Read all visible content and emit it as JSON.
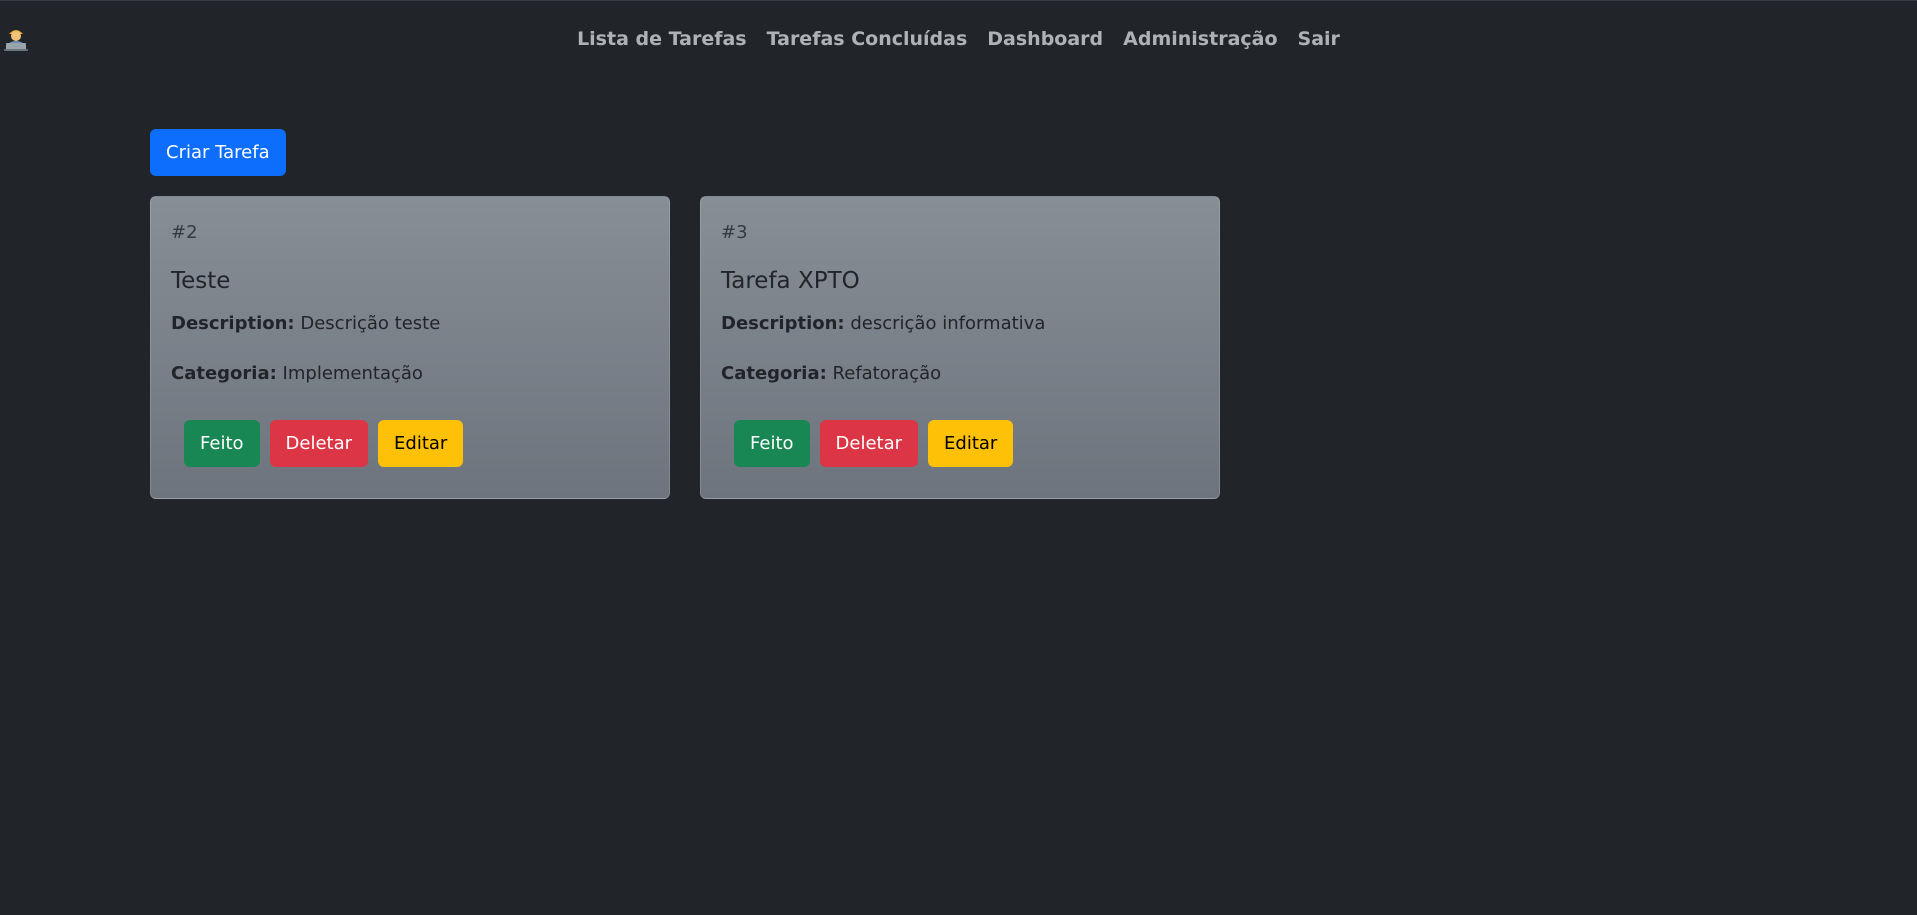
{
  "nav": {
    "brand_icon": "technologist-icon",
    "links": [
      {
        "label": "Lista de Tarefas"
      },
      {
        "label": "Tarefas Concluídas"
      },
      {
        "label": "Dashboard"
      },
      {
        "label": "Administração"
      },
      {
        "label": "Sair"
      }
    ]
  },
  "actions": {
    "create_label": "Criar Tarefa"
  },
  "tasks": [
    {
      "id": "#2",
      "title": "Teste",
      "description_label": "Description:",
      "description": "Descrição teste",
      "category_label": "Categoria:",
      "category": "Implementação",
      "done_label": "Feito",
      "delete_label": "Deletar",
      "edit_label": "Editar"
    },
    {
      "id": "#3",
      "title": "Tarefa XPTO",
      "description_label": "Description:",
      "description": "descrição informativa",
      "category_label": "Categoria:",
      "category": "Refatoração",
      "done_label": "Feito",
      "delete_label": "Deletar",
      "edit_label": "Editar"
    }
  ],
  "colors": {
    "background": "#212529",
    "primary": "#0d6efd",
    "success": "#198754",
    "danger": "#dc3545",
    "warning": "#ffc107",
    "card": "#868e96"
  }
}
